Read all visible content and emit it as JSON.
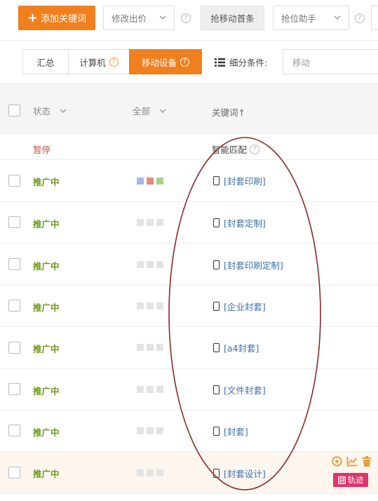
{
  "toolbar": {
    "add_keyword": "添加关键词",
    "change_bid": "修改出价",
    "grab_top": "抢移动首条",
    "rank_helper": "抢位助手"
  },
  "tabs": [
    {
      "label": "汇总",
      "help": false
    },
    {
      "label": "计算机",
      "help": true
    },
    {
      "label": "移动设备",
      "help": true,
      "active": true
    }
  ],
  "filter": {
    "label": "细分条件:",
    "value": "移动"
  },
  "table": {
    "headers": {
      "status": "状态",
      "all": "全部",
      "keyword": "关键词↑"
    },
    "group_row": {
      "status": "暂停",
      "match": "智能匹配"
    },
    "rows": [
      {
        "status": "推广中",
        "keyword": "[封套印刷]"
      },
      {
        "status": "推广中",
        "keyword": "[封套定制]"
      },
      {
        "status": "推广中",
        "keyword": "[封套印刷定制]"
      },
      {
        "status": "推广中",
        "keyword": "[企业封套]"
      },
      {
        "status": "推广中",
        "keyword": "[a4封套]"
      },
      {
        "status": "推广中",
        "keyword": "[文件封套]"
      },
      {
        "status": "推广中",
        "keyword": "[封套]"
      },
      {
        "status": "推广中",
        "keyword": "[封套设计]"
      }
    ]
  },
  "trace_label": "轨迹",
  "colors": {
    "accent": "#f07f1d",
    "status_green": "#6a9a18",
    "paused": "#c9533b",
    "link": "#3c6fa8",
    "annotation": "#8b2a2a",
    "trace": "#e2336b"
  }
}
